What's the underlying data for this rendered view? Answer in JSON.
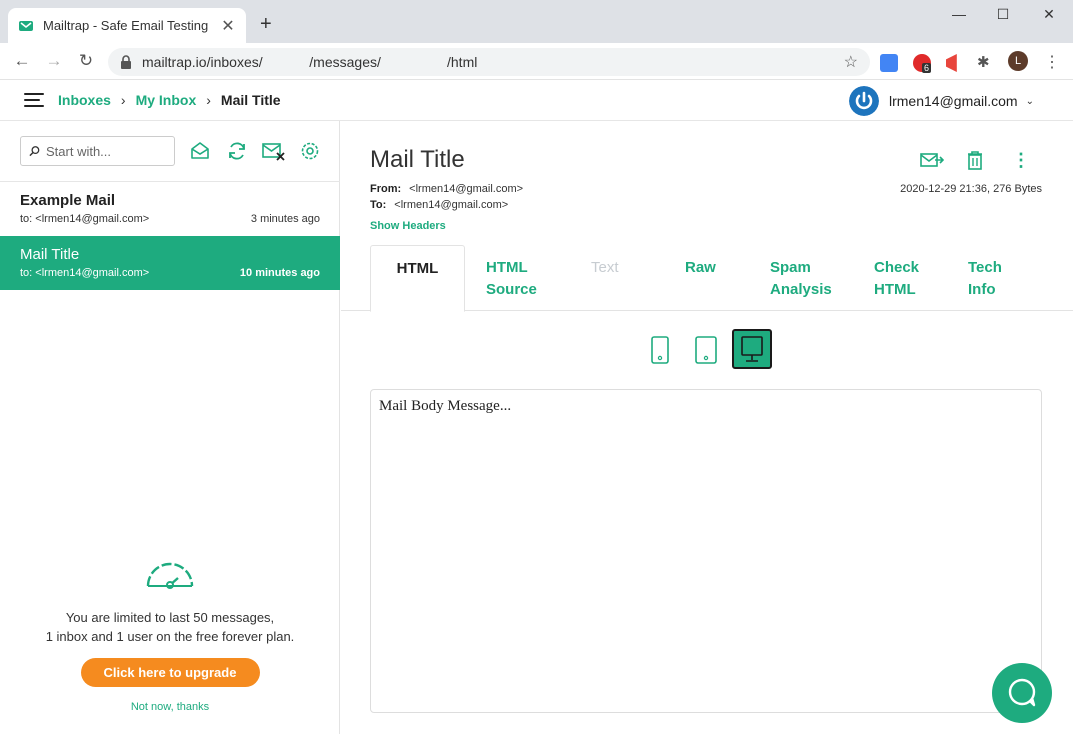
{
  "browser": {
    "tab_title": "Mailtrap - Safe Email Testing",
    "tab_close": "✕",
    "new_tab": "+",
    "url": "mailtrap.io/inboxes/            /messages/                 /html",
    "ext_badge": "6",
    "profile_initial": "L",
    "window_controls": {
      "minimize": "—",
      "maximize": "☐",
      "close": "✕"
    }
  },
  "header": {
    "breadcrumbs": [
      "Inboxes",
      "My Inbox",
      "Mail Title"
    ],
    "account_email": "lrmen14@gmail.com",
    "icons": {
      "menu": "hamburger-icon",
      "account": "power-icon"
    }
  },
  "sidebar": {
    "search_placeholder": "Start with...",
    "toolbar_icons": [
      "open-envelope-icon",
      "refresh-icon",
      "clear-inbox-icon",
      "settings-icon"
    ],
    "messages": [
      {
        "subject": "Example Mail",
        "to": "to: <lrmen14@gmail.com>",
        "time": "3 minutes ago",
        "selected": false
      },
      {
        "subject": "Mail Title",
        "to": "to: <lrmen14@gmail.com>",
        "time": "10 minutes ago",
        "selected": true
      }
    ],
    "limit": {
      "line1": "You are limited to last 50 messages,",
      "line2": "1 inbox and 1 user on the free forever plan.",
      "upgrade_label": "Click here to upgrade",
      "dismiss_label": "Not now, thanks"
    }
  },
  "message": {
    "title": "Mail Title",
    "from_label": "From:",
    "from_value": "<lrmen14@gmail.com>",
    "to_label": "To:",
    "to_value": "<lrmen14@gmail.com>",
    "date_size": "2020-12-29 21:36, 276 Bytes",
    "show_headers": "Show Headers",
    "tabs": [
      {
        "line1": "HTML",
        "line2": "",
        "state": "active"
      },
      {
        "line1": "HTML",
        "line2": "Source",
        "state": "normal"
      },
      {
        "line1": "Text",
        "line2": "",
        "state": "disabled"
      },
      {
        "line1": "Raw",
        "line2": "",
        "state": "normal"
      },
      {
        "line1": "Spam",
        "line2": "Analysis",
        "state": "normal"
      },
      {
        "line1": "Check",
        "line2": "HTML",
        "state": "normal"
      },
      {
        "line1": "Tech",
        "line2": "Info",
        "state": "normal"
      }
    ],
    "device_views": [
      "phone",
      "tablet",
      "desktop"
    ],
    "active_device": "desktop",
    "body": "Mail Body Message..."
  },
  "colors": {
    "brand": "#1eab7f",
    "upgrade": "#f58b1f",
    "account": "#1d74bd"
  }
}
